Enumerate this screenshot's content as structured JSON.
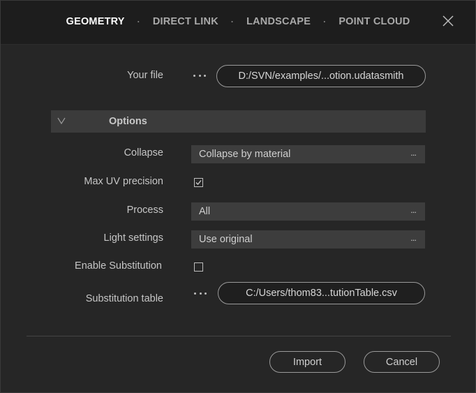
{
  "tabs": [
    {
      "label": "GEOMETRY",
      "active": true
    },
    {
      "label": "DIRECT LINK",
      "active": false
    },
    {
      "label": "LANDSCAPE",
      "active": false
    },
    {
      "label": "POINT CLOUD",
      "active": false
    }
  ],
  "tab_separator": "·",
  "file": {
    "label": "Your file",
    "path": "D:/SVN/examples/...otion.udatasmith"
  },
  "options": {
    "title": "Options",
    "collapse": {
      "label": "Collapse",
      "value": "Collapse by material"
    },
    "max_uv_precision": {
      "label": "Max UV precision",
      "checked": true
    },
    "process": {
      "label": "Process",
      "value": "All"
    },
    "light_settings": {
      "label": "Light settings",
      "value": "Use original"
    },
    "enable_substitution": {
      "label": "Enable Substitution",
      "checked": false
    },
    "substitution_table": {
      "label": "Substitution table",
      "path": "C:/Users/thom83...tutionTable.csv"
    }
  },
  "select_ellipsis": "...",
  "buttons": {
    "import": "Import",
    "cancel": "Cancel"
  },
  "colors": {
    "background": "#262626",
    "header": "#1d1d1d",
    "section": "#3b3b3b",
    "select": "#3d3d3d"
  },
  "icons": {
    "close": "close-icon",
    "collapse": "chevron-down-icon",
    "browse": "more-horizontal-icon",
    "check": "checkmark-icon"
  }
}
